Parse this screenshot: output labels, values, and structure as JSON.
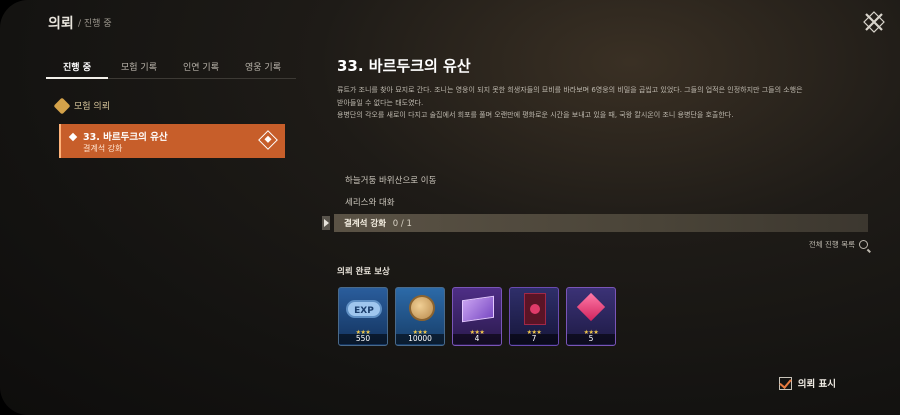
{
  "header": {
    "title": "의뢰",
    "subtitle": "/ 진행 중"
  },
  "tabs": [
    {
      "label": "진행 중",
      "active": true
    },
    {
      "label": "모험 기록",
      "active": false
    },
    {
      "label": "인연 기록",
      "active": false
    },
    {
      "label": "영웅 기록",
      "active": false
    }
  ],
  "sidebar": {
    "category": "모험 의뢰",
    "quest": {
      "title": "33. 바르두크의 유산",
      "subtitle": "결계석 강화"
    }
  },
  "detail": {
    "title": "33. 바르두크의 유산",
    "description": [
      "류트가 조니를 찾아 묘지로 간다. 조니는 영웅이 되지 못한 희생자들의 묘비를 바라보며 6영웅의 비밀을 곱씹고 있었다. 그들의 업적은 인정하지만 그들의 소행은",
      "받아들일 수 없다는 태도였다.",
      "용병단의 각오를 새로이 다지고 술집에서 회포를 풀며 오랜만에 평화로운 시간을 보내고 있을 때, 국왕 칼시온이 조니 용병단을 호출한다."
    ],
    "objectives": [
      {
        "text": "하늘거둥 바위산으로 이동"
      },
      {
        "text": "세리스와 대화"
      }
    ],
    "current_objective": {
      "text": "결계석 강화",
      "count": "0 / 1"
    },
    "all_progress_label": "전체 진행 목록",
    "reward_label": "의뢰 완료 보상",
    "rewards": [
      {
        "icon": "exp-icon",
        "exp_text": "EXP",
        "stars": "★★★",
        "qty": "550"
      },
      {
        "icon": "gold-coin-icon",
        "stars": "★★★",
        "qty": "10000"
      },
      {
        "icon": "magic-book-icon",
        "stars": "★★★",
        "qty": "4"
      },
      {
        "icon": "card-icon",
        "stars": "★★★",
        "qty": "7"
      },
      {
        "icon": "gem-icon",
        "stars": "★★★",
        "qty": "5"
      }
    ]
  },
  "footer": {
    "show_label": "의뢰 표시"
  }
}
